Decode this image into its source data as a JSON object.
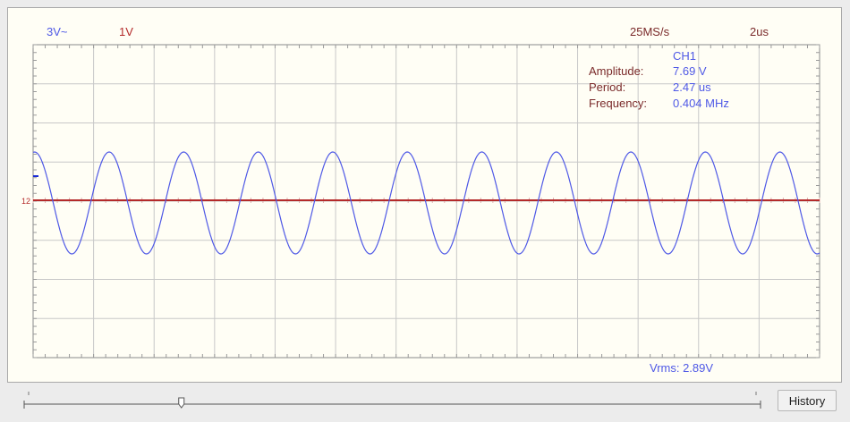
{
  "header": {
    "ch1_scale": "3V~",
    "ch2_scale": "1V",
    "sample_rate": "25MS/s",
    "timebase": "2us"
  },
  "measurements": {
    "channel": "CH1",
    "amplitude_label": "Amplitude:",
    "amplitude_value": "7.69 V",
    "period_label": "Period:",
    "period_value": "2.47 us",
    "frequency_label": "Frequency:",
    "frequency_value": "0.404 MHz"
  },
  "markers": {
    "ref_level_label": "12"
  },
  "footer": {
    "vrms": "Vrms: 2.89V",
    "history_button": "History"
  },
  "history_slider": {
    "position": 0.25
  },
  "colors": {
    "ch1": "#4f59e6",
    "ch2": "#b42a2a",
    "grid": "#c8c8c8",
    "background": "#fffef5"
  }
}
